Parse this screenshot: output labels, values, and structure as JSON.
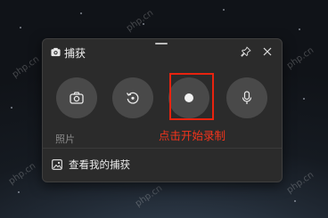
{
  "window": {
    "title": "捕获",
    "title_icon": "camera-icon",
    "pin_icon": "pin-icon",
    "close_icon": "close-icon"
  },
  "capture_buttons": [
    {
      "name": "screenshot",
      "icon": "camera-icon"
    },
    {
      "name": "recent",
      "icon": "history-icon"
    },
    {
      "name": "record",
      "icon": "record-dot-icon"
    },
    {
      "name": "microphone",
      "icon": "microphone-icon"
    }
  ],
  "mode_label": "照片",
  "gallery_link": {
    "icon": "gallery-icon",
    "label": "查看我的捕获"
  },
  "annotation": "点击开始录制",
  "watermark": "php.cn",
  "colors": {
    "panel": "#2b2b2b",
    "button": "#494949",
    "highlight": "#e8230f",
    "annotation": "#f2341c"
  }
}
